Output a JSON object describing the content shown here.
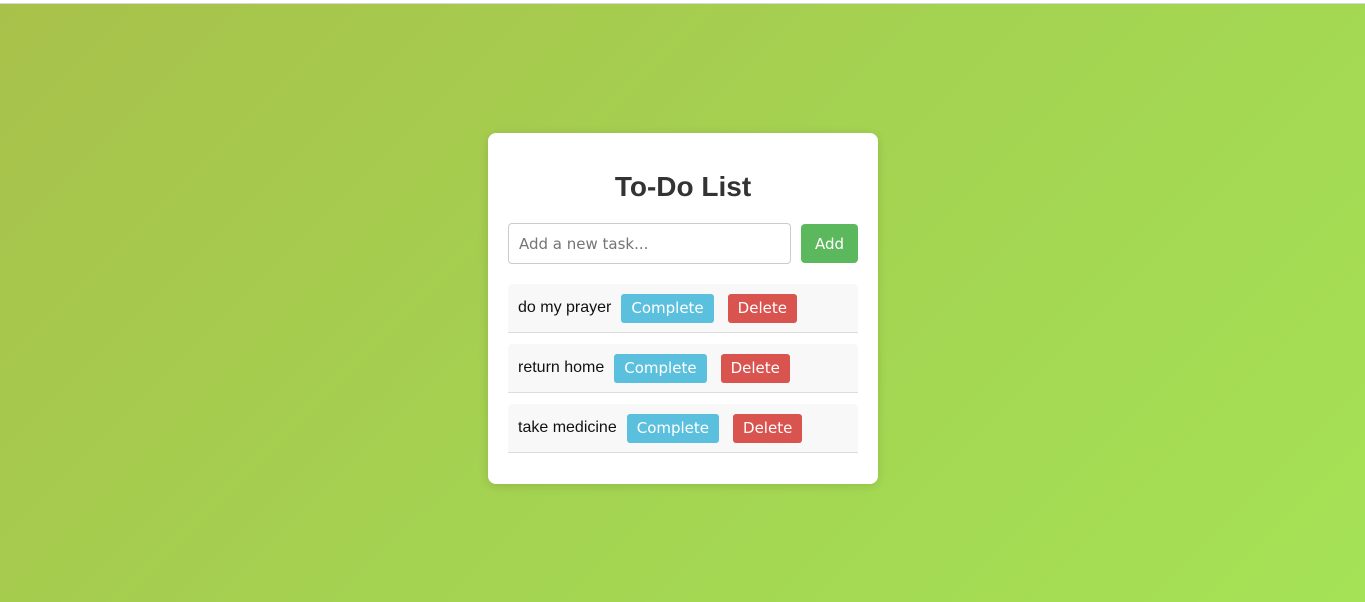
{
  "colors": {
    "background_gradient_start": "#a8c14a",
    "background_gradient_end": "#a5e256",
    "add_button": "#5cb85c",
    "complete_button": "#5bc0de",
    "delete_button": "#d9534f"
  },
  "app": {
    "title": "To-Do List"
  },
  "new_task": {
    "value": "",
    "placeholder": "Add a new task...",
    "add_label": "Add"
  },
  "tasks": [
    {
      "text": "do my prayer",
      "complete_label": "Complete",
      "delete_label": "Delete"
    },
    {
      "text": "return home",
      "complete_label": "Complete",
      "delete_label": "Delete"
    },
    {
      "text": "take medicine",
      "complete_label": "Complete",
      "delete_label": "Delete"
    }
  ]
}
